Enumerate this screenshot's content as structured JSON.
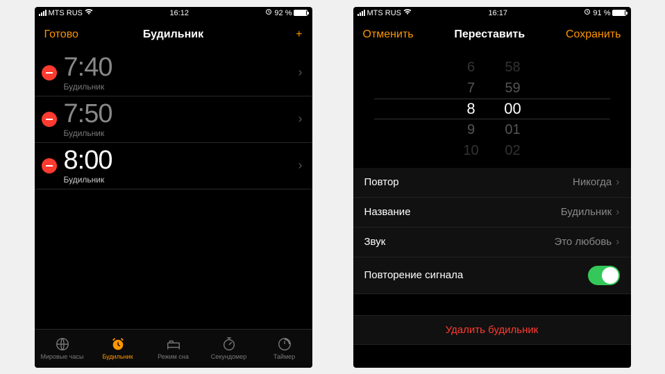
{
  "left": {
    "status": {
      "carrier": "MTS RUS",
      "time": "16:12",
      "battery": "92 %"
    },
    "nav": {
      "left": "Готово",
      "title": "Будильник",
      "right": "+"
    },
    "alarms": [
      {
        "time": "7:40",
        "label": "Будильник",
        "active": false
      },
      {
        "time": "7:50",
        "label": "Будильник",
        "active": false
      },
      {
        "time": "8:00",
        "label": "Будильник",
        "active": true
      }
    ],
    "tabs": [
      {
        "label": "Мировые часы"
      },
      {
        "label": "Будильник"
      },
      {
        "label": "Режим сна"
      },
      {
        "label": "Секундомер"
      },
      {
        "label": "Таймер"
      }
    ]
  },
  "right": {
    "status": {
      "carrier": "MTS RUS",
      "time": "16:17",
      "battery": "91 %"
    },
    "nav": {
      "left": "Отменить",
      "title": "Переставить",
      "right": "Сохранить"
    },
    "picker": {
      "hours": [
        "6",
        "7",
        "8",
        "9",
        "10"
      ],
      "mins": [
        "58",
        "59",
        "00",
        "01",
        "02"
      ],
      "selected_h": "8",
      "selected_m": "00"
    },
    "settings": [
      {
        "label": "Повтор",
        "value": "Никогда",
        "chevron": true
      },
      {
        "label": "Название",
        "value": "Будильник",
        "chevron": true
      },
      {
        "label": "Звук",
        "value": "Это любовь",
        "chevron": true
      },
      {
        "label": "Повторение сигнала",
        "toggle": true
      }
    ],
    "delete": "Удалить будильник"
  }
}
